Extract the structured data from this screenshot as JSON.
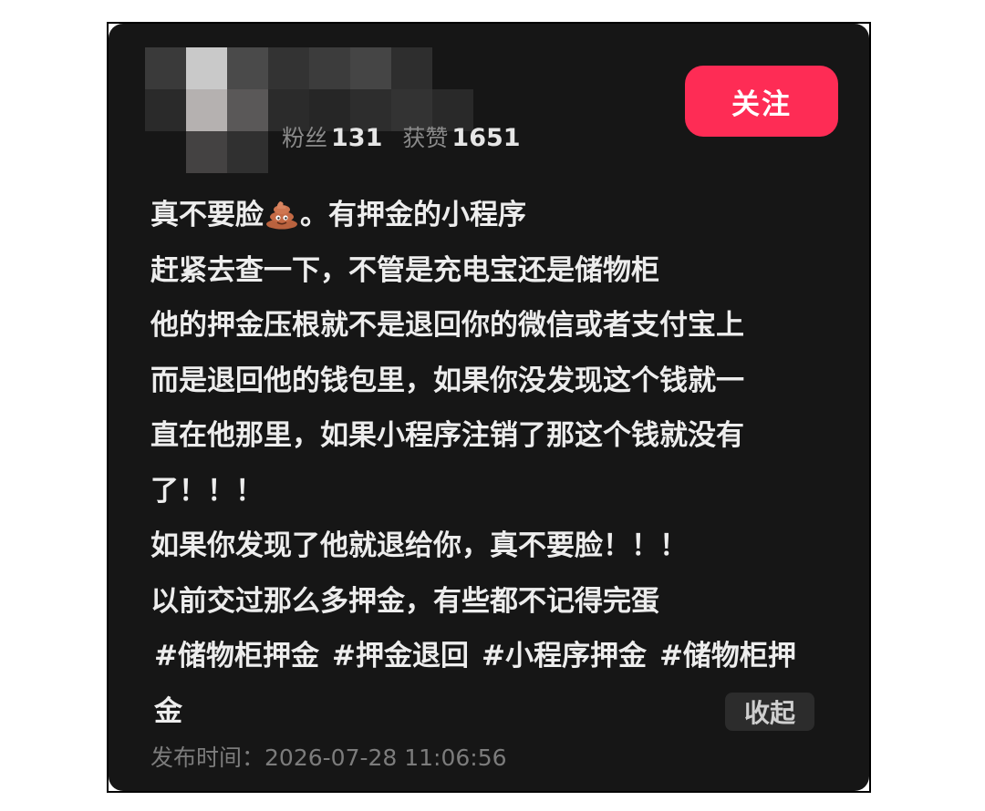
{
  "profile": {
    "follow_label": "关注",
    "fans_label": "粉丝",
    "fans_count": "131",
    "likes_label": "获赞",
    "likes_count": "1651"
  },
  "post": {
    "lines": [
      "真不要脸",
      "。有押金的小程序",
      "赶紧去查一下，不管是充电宝还是储物柜",
      "他的押金压根就不是退回你的微信或者支付宝上",
      "而是退回他的钱包里，如果你没发现这个钱就一",
      "直在他那里，如果小程序注销了那这个钱就没有",
      "了！！！",
      "如果你发现了他就退给你，真不要脸！！！",
      "以前交过那么多押金，有些都不记得完蛋"
    ],
    "emoji_icon": "poop-emoji-icon",
    "hashtags": [
      "#储物柜押金",
      "#押金退回",
      "#小程序押金",
      "#储物柜押金"
    ],
    "collapse_label": "收起",
    "publish_label": "发布时间：",
    "publish_time": "2026-07-28 11:06:56"
  },
  "colors": {
    "card_bg": "#161616",
    "follow_button": "#fe2c55",
    "text_primary": "#ededed",
    "text_secondary": "#7c7c7c"
  }
}
